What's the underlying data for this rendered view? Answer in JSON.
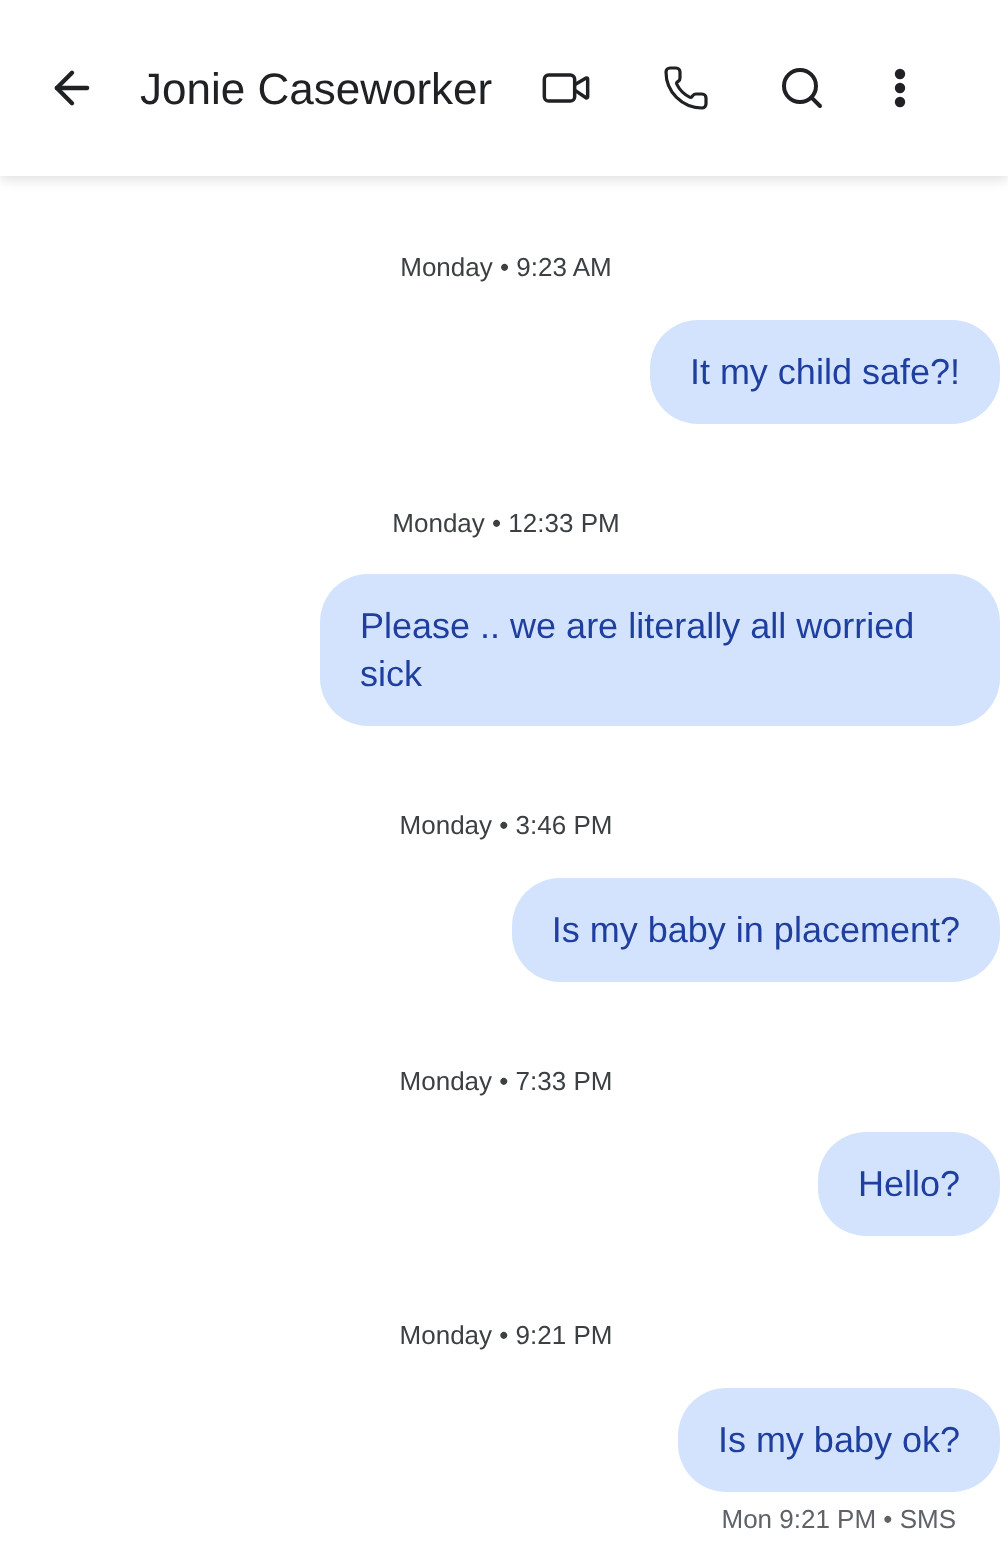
{
  "header": {
    "title": "Jonie Caseworker"
  },
  "messages": [
    {
      "timestamp": "Monday • 9:23 AM",
      "text": "It my child safe?!"
    },
    {
      "timestamp": "Monday • 12:33 PM",
      "text": "Please .. we are literally all worried sick"
    },
    {
      "timestamp": "Monday • 3:46 PM",
      "text": "Is my baby in placement?"
    },
    {
      "timestamp": "Monday • 7:33 PM",
      "text": "Hello?"
    },
    {
      "timestamp": "Monday • 9:21 PM",
      "text": "Is my baby ok?"
    }
  ],
  "status": "Mon 9:21 PM • SMS"
}
